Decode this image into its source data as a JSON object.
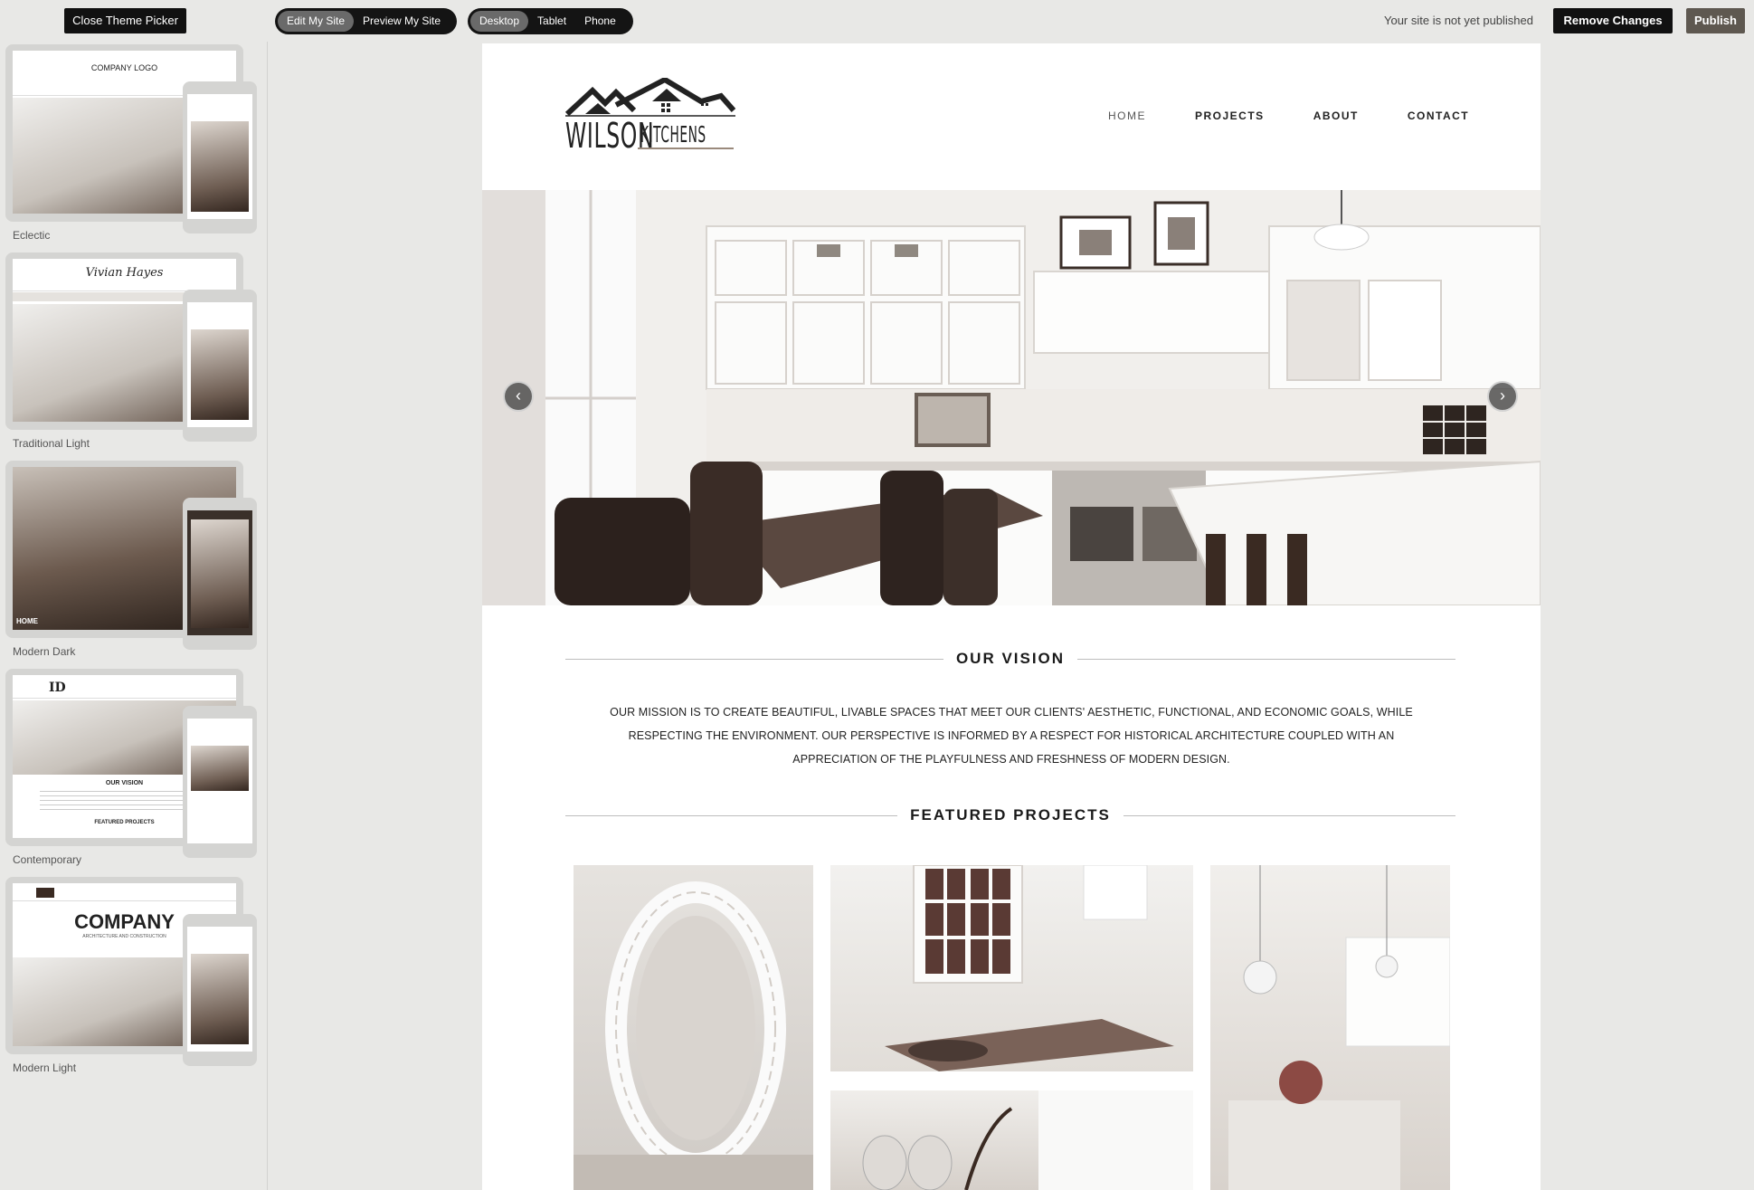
{
  "toolbar": {
    "close_picker": "Close Theme Picker",
    "mode_options": [
      "Edit My Site",
      "Preview My Site"
    ],
    "device_options": [
      "Desktop",
      "Tablet",
      "Phone"
    ],
    "status": "Your site is not yet published",
    "remove_changes": "Remove Changes",
    "publish": "Publish"
  },
  "themes": [
    {
      "label": "Eclectic",
      "logo_text": "COMPANY LOGO"
    },
    {
      "label": "Traditional Light",
      "logo_text": "Vivian Hayes"
    },
    {
      "label": "Modern Dark",
      "logo_text": "HOME"
    },
    {
      "label": "Contemporary",
      "logo_text": "ID",
      "vision": "OUR VISION",
      "featured": "FEATURED PROJECTS"
    },
    {
      "label": "Modern Light",
      "logo_text": "COMPANY",
      "sub": "ARCHITECTURE AND CONSTRUCTION"
    }
  ],
  "site": {
    "logo_left": "WILSON",
    "logo_right": "KITCHENS",
    "nav": [
      "HOME",
      "PROJECTS",
      "ABOUT",
      "CONTACT"
    ],
    "vision_title": "OUR VISION",
    "mission_lines": [
      "OUR MISSION IS TO CREATE BEAUTIFUL, LIVABLE SPACES THAT MEET OUR CLIENTS' AESTHETIC, FUNCTIONAL, AND ECONOMIC GOALS, WHILE",
      "RESPECTING THE ENVIRONMENT. OUR PERSPECTIVE IS INFORMED BY A RESPECT FOR HISTORICAL ARCHITECTURE COUPLED WITH AN",
      "APPRECIATION OF THE PLAYFULNESS AND FRESHNESS OF MODERN DESIGN."
    ],
    "featured_title": "FEATURED PROJECTS",
    "prev_arrow": "‹",
    "next_arrow": "›"
  }
}
